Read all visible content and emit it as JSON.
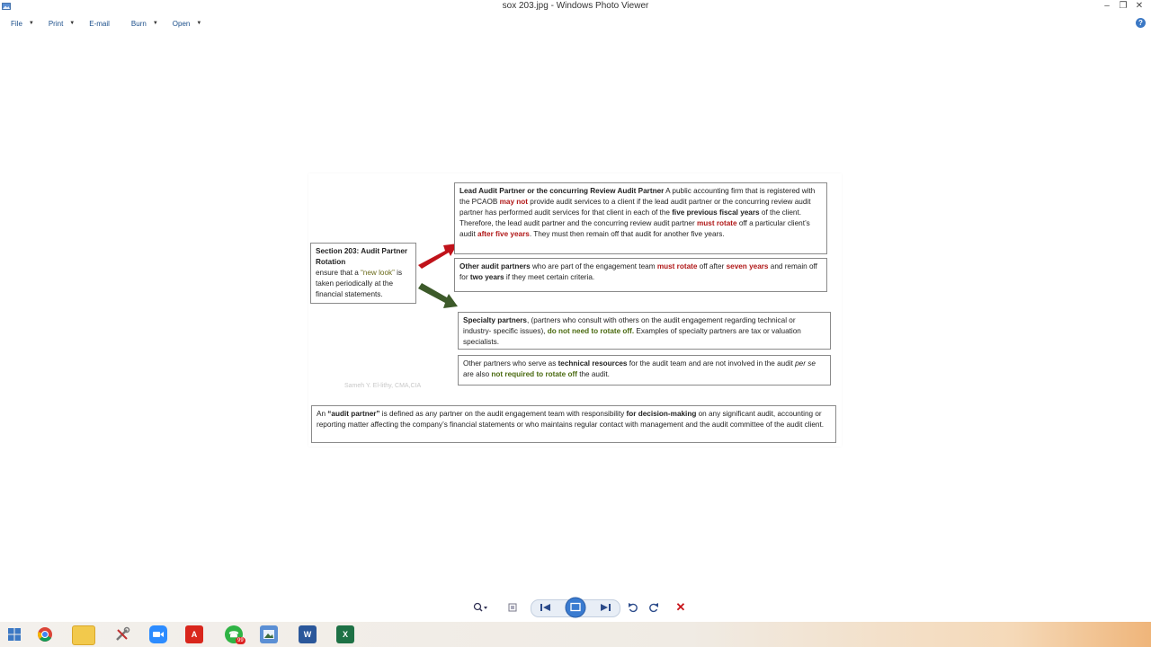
{
  "window": {
    "title": "sox 203.jpg - Windows Photo Viewer"
  },
  "menu": {
    "items": [
      {
        "label": "File",
        "has_dropdown": true
      },
      {
        "label": "Print",
        "has_dropdown": true
      },
      {
        "label": "E-mail",
        "has_dropdown": false
      },
      {
        "label": "Burn",
        "has_dropdown": true
      },
      {
        "label": "Open",
        "has_dropdown": true
      }
    ]
  },
  "slide": {
    "section_box": {
      "title": "Section 203: Audit Partner Rotation",
      "text_pre": "ensure that a ",
      "highlight": "“new look”",
      "text_post": " is taken periodically at the financial statements."
    },
    "lead_box": {
      "heading": "Lead Audit Partner or the concurring Review Audit Partner",
      "t1": "  A public accounting firm that is registered with the PCAOB ",
      "r1": "may not",
      "t2": " provide audit services to a client if the lead audit partner or the concurring review audit partner has performed audit services for that client in each of the ",
      "b1": "five previous fiscal years",
      "t3": " of the client. Therefore, the lead audit partner and the concurring review audit partner ",
      "r2": "must rotate",
      "t4": " off a particular client’s audit ",
      "r3": "after five years",
      "t5": ". They must then remain off that audit for another five years."
    },
    "other_box": {
      "heading": "Other audit partners",
      "t1": " who are part of the engagement team ",
      "r1": "must rotate",
      "t2": " off after ",
      "r2": "seven years",
      "t3": " and remain off for ",
      "b1": "two years",
      "t4": " if they meet certain criteria."
    },
    "specialty_box": {
      "heading": "Specialty partners",
      "t1": ", (partners who consult with others on the audit engagement regarding technical or industry- specific issues), ",
      "g1": "do not need to rotate off.",
      "t2": "  Examples of specialty partners are tax or valuation specialists."
    },
    "technical_box": {
      "t1": "Other partners who serve as ",
      "b1": "technical resources",
      "t2": " for the audit team and are not involved in the audit ",
      "i1": "per se",
      "t3": " are also ",
      "g1": "not required to rotate off",
      "t4": " the audit."
    },
    "definition_box": {
      "t1": "An ",
      "b1": "“audit partner”",
      "t2": " is defined as any partner on the audit engagement team with responsibility ",
      "b2": "for decision-making",
      "t3": " on any significant audit, accounting or reporting matter affecting the company’s financial statements or who maintains regular contact with management and the audit committee of the audit client."
    },
    "watermark": "Sameh Y. El-lithy, CMA,CIA"
  },
  "toolbar": {
    "buttons": [
      "zoom-icon",
      "actual-size-icon",
      "previous-icon",
      "slideshow-icon",
      "next-icon",
      "rotate-left-icon",
      "rotate-right-icon",
      "delete-icon"
    ]
  },
  "taskbar": {
    "apps": [
      "windows-start-icon",
      "chrome-icon",
      "file-explorer-icon",
      "tools-icon",
      "zoom-app-icon",
      "acrobat-icon",
      "whatsapp-icon",
      "photo-viewer-icon",
      "word-icon",
      "excel-icon"
    ],
    "whatsapp_badge": "99"
  },
  "colors": {
    "red_arrow": "#c0121a",
    "green_arrow": "#3d5a2a",
    "emphasis_red": "#b01818",
    "emphasis_green": "#4a6a10"
  }
}
